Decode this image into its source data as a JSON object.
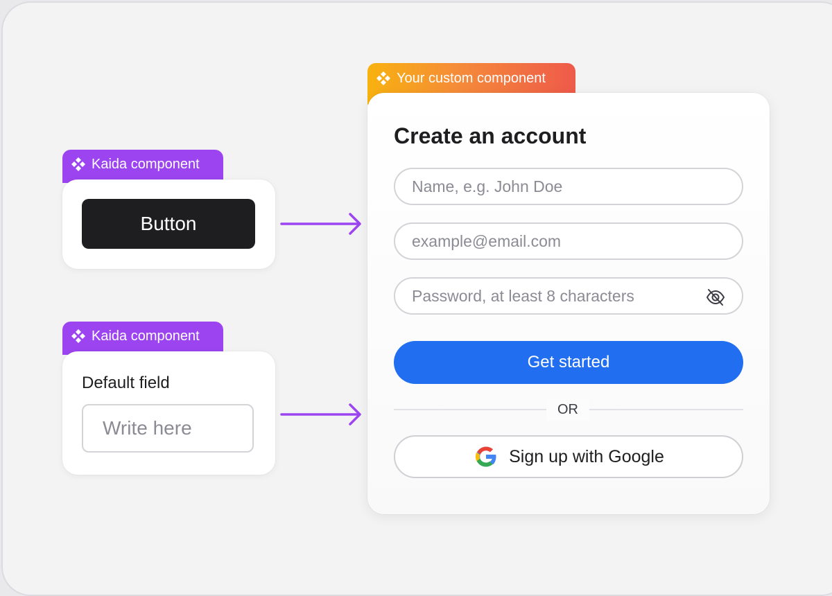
{
  "tags": {
    "kaida_label": "Kaida component",
    "custom_label": "Your custom component"
  },
  "button_card": {
    "button_label": "Button"
  },
  "field_card": {
    "label": "Default field",
    "placeholder": "Write here"
  },
  "signup": {
    "title": "Create an account",
    "name_placeholder": "Name, e.g. John Doe",
    "email_placeholder": "example@email.com",
    "password_placeholder": "Password, at least 8 characters",
    "submit_label": "Get started",
    "divider_text": "OR",
    "google_label": "Sign up with Google"
  },
  "icons": {
    "tag_icon": "component-diamond-icon",
    "password_toggle": "eye-off-icon",
    "google": "google-logo-icon",
    "arrow": "arrow-right-icon"
  },
  "colors": {
    "kaida_purple": "#9b44f0",
    "custom_gradient_start": "#f8b20f",
    "custom_gradient_end": "#ee5a4a",
    "primary_blue": "#216ff0",
    "dark_button": "#1e1e20",
    "arrow_purple": "#9b44f0"
  }
}
